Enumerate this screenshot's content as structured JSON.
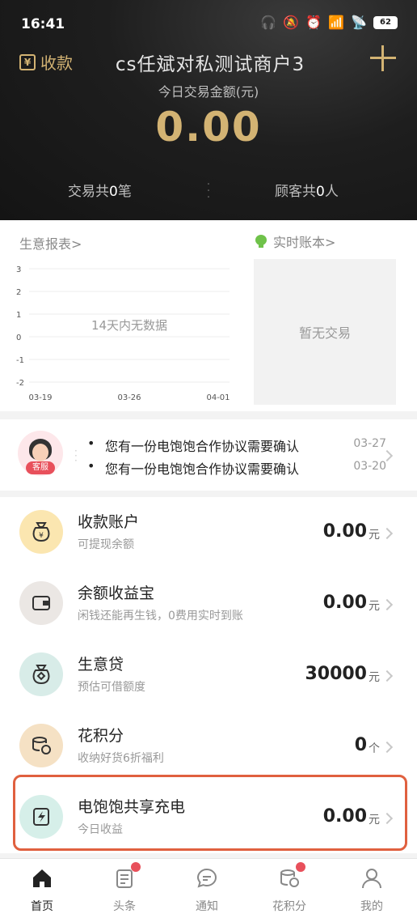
{
  "status_bar": {
    "time": "16:41",
    "battery": "62"
  },
  "header": {
    "collect_label": "收款",
    "collect_icon_glyph": "¥",
    "merchant_name": "cs任斌对私测试商户3",
    "amount_label": "今日交易金额(元)",
    "amount_value": "0.00",
    "tx_prefix": "交易共",
    "tx_count": "0",
    "tx_suffix": "笔",
    "customer_prefix": "顾客共",
    "customer_count": "0",
    "customer_suffix": "人",
    "accent_color": "#d3b373"
  },
  "report": {
    "title": "生意报表>",
    "ledger_title": "实时账本>",
    "empty_ledger": "暂无交易",
    "no_data": "14天内无数据"
  },
  "chart_data": {
    "type": "line",
    "x_ticks": [
      "03-19",
      "03-26",
      "04-01"
    ],
    "y_ticks": [
      3,
      2,
      1,
      0,
      -1,
      -2
    ],
    "ylim": [
      -2,
      3
    ],
    "series": [],
    "annotation": "14天内无数据",
    "grid": true
  },
  "notices": {
    "avatar_label": "客服",
    "items": [
      {
        "bullet": "•",
        "text": "您有一份电饱饱合作协议需要确认",
        "date": "03-27"
      },
      {
        "bullet": "•",
        "text": "您有一份电饱饱合作协议需要确认",
        "date": "03-20"
      }
    ]
  },
  "list": [
    {
      "title": "收款账户",
      "subtitle": "可提现余额",
      "value": "0.00",
      "unit": "元",
      "icon": "money-bag-icon"
    },
    {
      "title": "余额收益宝",
      "subtitle": "闲钱还能再生钱，0费用实时到账",
      "value": "0.00",
      "unit": "元",
      "icon": "wallet-icon"
    },
    {
      "title": "生意贷",
      "subtitle": "预估可借额度",
      "value": "30000",
      "unit": "元",
      "icon": "loan-bag-icon"
    },
    {
      "title": "花积分",
      "subtitle": "收纳好货6折福利",
      "value": "0",
      "unit": "个",
      "icon": "coins-icon"
    },
    {
      "title": "电饱饱共享充电",
      "subtitle": "今日收益",
      "value": "0.00",
      "unit": "元",
      "icon": "charging-icon"
    }
  ],
  "nav": [
    {
      "label": "首页",
      "icon": "home-icon",
      "active": true
    },
    {
      "label": "头条",
      "icon": "news-icon",
      "badge": true
    },
    {
      "label": "通知",
      "icon": "chat-icon"
    },
    {
      "label": "花积分",
      "icon": "coins-icon",
      "badge": true
    },
    {
      "label": "我的",
      "icon": "profile-icon"
    }
  ]
}
